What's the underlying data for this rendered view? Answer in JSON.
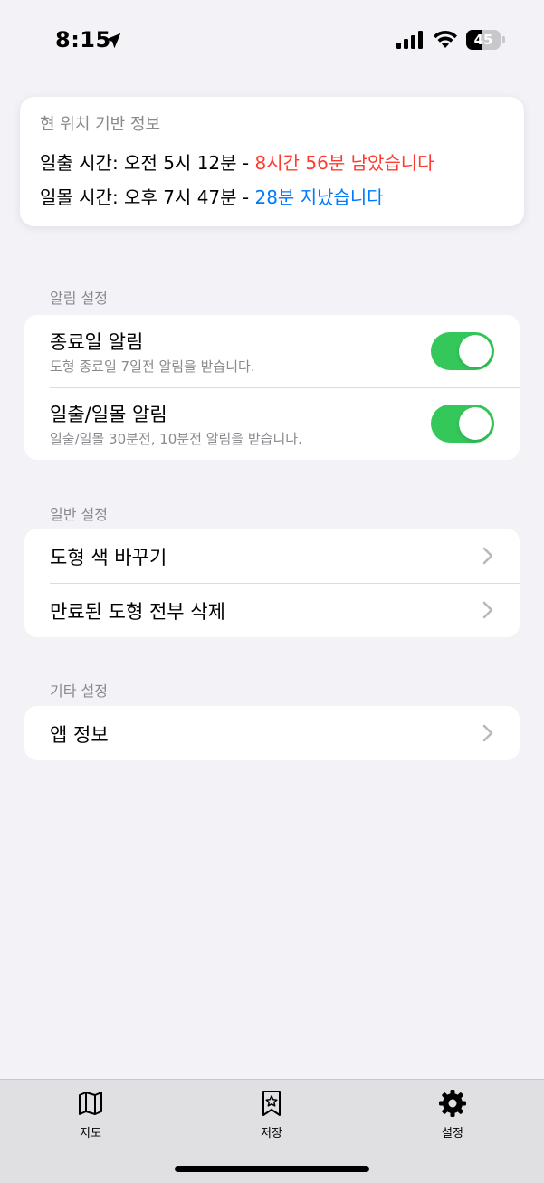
{
  "status_bar": {
    "time": "8:15",
    "battery": "45",
    "battery_level": 0.45
  },
  "location_card": {
    "title": "현 위치 기반 정보",
    "sunrise": {
      "label": "일출 시간: 오전 5시 12분 - ",
      "remaining": "8시간 56분 남았습니다"
    },
    "sunset": {
      "label": "일몰 시간: 오후 7시 47분 - ",
      "passed": "28분 지났습니다"
    }
  },
  "notification_section": {
    "header": "알림 설정",
    "items": [
      {
        "title": "종료일 알림",
        "subtitle": "도형 종료일 7일전 알림을 받습니다.",
        "enabled": true
      },
      {
        "title": "일출/일몰 알림",
        "subtitle": "일출/일몰 30분전, 10분전 알림을 받습니다.",
        "enabled": true
      }
    ]
  },
  "general_section": {
    "header": "일반 설정",
    "items": [
      {
        "title": "도형 색 바꾸기"
      },
      {
        "title": "만료된 도형 전부 삭제"
      }
    ]
  },
  "other_section": {
    "header": "기타 설정",
    "items": [
      {
        "title": "앱 정보"
      }
    ]
  },
  "tab_bar": {
    "tabs": [
      {
        "label": "지도",
        "icon": "map-icon"
      },
      {
        "label": "저장",
        "icon": "bookmark-star-icon"
      },
      {
        "label": "설정",
        "icon": "gear-icon",
        "selected": true
      }
    ]
  },
  "colors": {
    "background": "#f2f2f7",
    "toggle_on": "#34c759",
    "remaining_text": "#ff3b30",
    "passed_text": "#007aff",
    "secondary_text": "#8a8a8e"
  }
}
